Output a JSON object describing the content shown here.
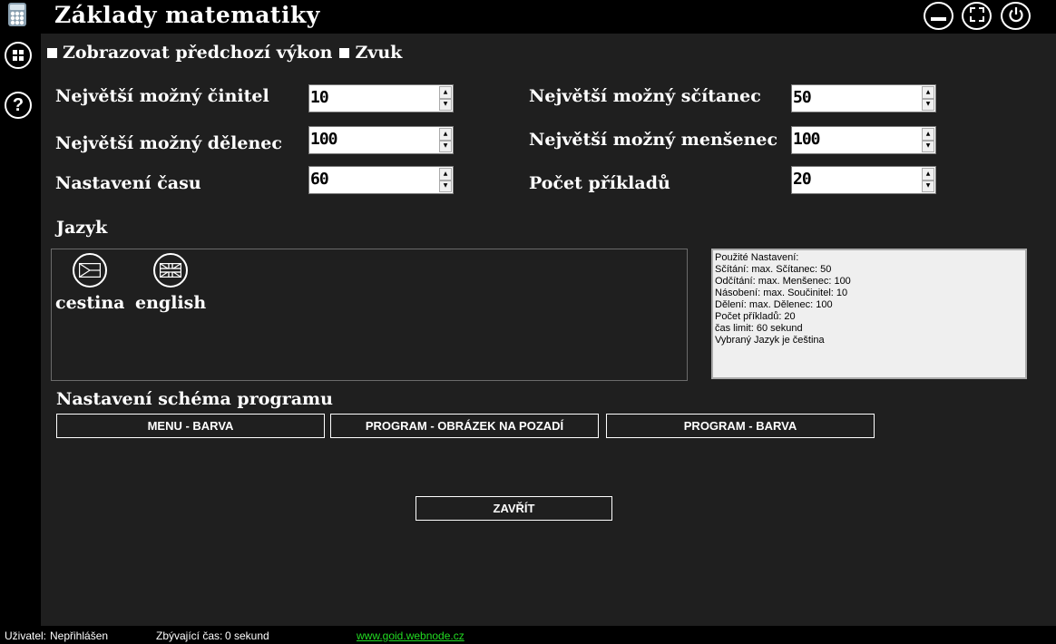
{
  "app": {
    "title": "Základy matematiky"
  },
  "options": {
    "show_previous_label": "Zobrazovat předchozí výkon",
    "sound_label": "Zvuk"
  },
  "settings": {
    "max_factor_label": "Největší možný činitel",
    "max_factor_value": "10",
    "max_dividend_label": "Největší možný dělenec",
    "max_dividend_value": "100",
    "time_label": "Nastavení času",
    "time_value": "60",
    "max_addend_label": "Největší možný sčítanec",
    "max_addend_value": "50",
    "max_minuend_label": "Největší možný menšenec",
    "max_minuend_value": "100",
    "count_label": "Počet příkladů",
    "count_value": "20"
  },
  "language": {
    "heading": "Jazyk",
    "items": [
      {
        "label": "cestina",
        "icon": "czech-flag-icon"
      },
      {
        "label": "english",
        "icon": "uk-flag-icon"
      }
    ]
  },
  "summary": {
    "lines": [
      "Použité Nastavení:",
      "Sčítání: max. Sčítanec: 50",
      "Odčítání: max. Menšenec: 100",
      "Násobení: max. Součinitel: 10",
      "Dělení: max. Dělenec: 100",
      "Počet příkladů: 20",
      "čas limit: 60 sekund",
      "Vybraný Jazyk je čeština"
    ]
  },
  "scheme": {
    "heading": "Nastavení schéma programu",
    "menu_color": "MENU - BARVA",
    "background_image": "PROGRAM - OBRÁZEK NA POZADÍ",
    "program_color": "PROGRAM - BARVA"
  },
  "close_label": "ZAVŘÍT",
  "status": {
    "user_label": "Uživatel:",
    "user_value": "Nepřihlášen",
    "remaining_label": "Zbývající čas:",
    "remaining_value": "0 sekund",
    "link": "www.goid.webnode.cz"
  },
  "colors": {
    "panel": "#1f1f1f",
    "chrome": "#000000",
    "link": "#22dd22"
  }
}
